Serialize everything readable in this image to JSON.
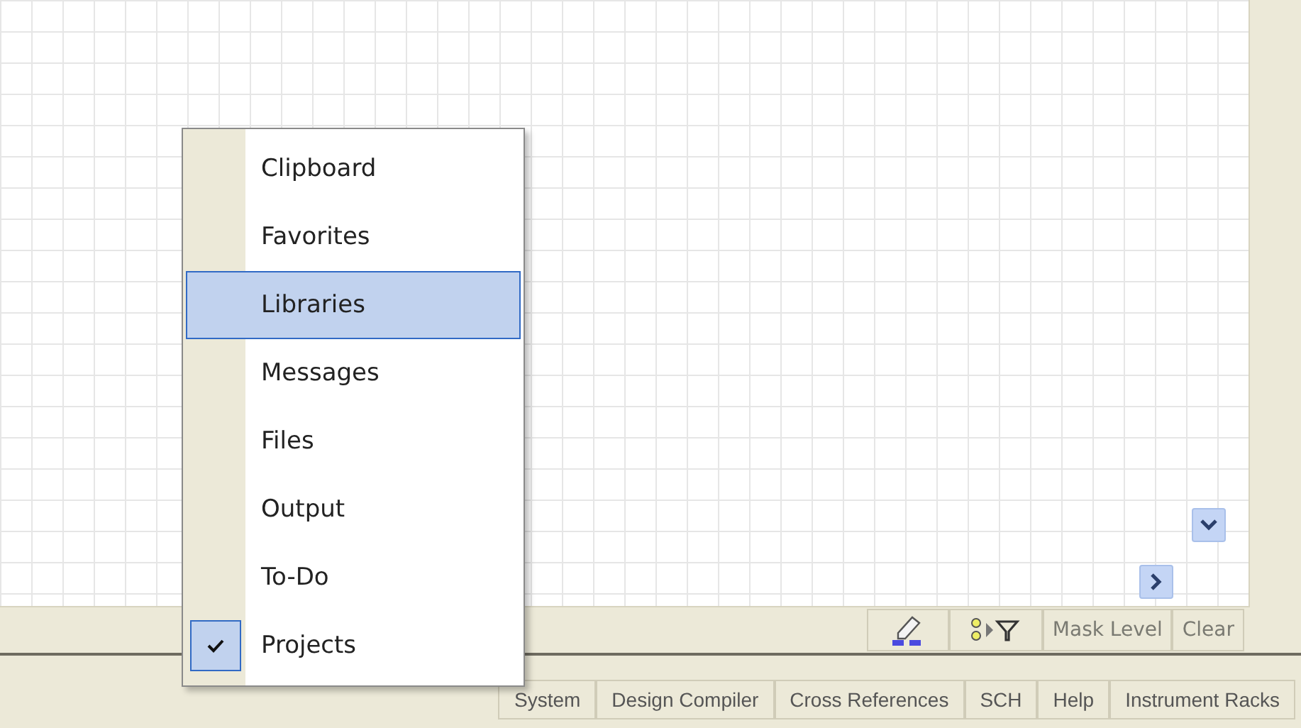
{
  "popup_menu": {
    "items": [
      {
        "label": "Clipboard",
        "selected": false,
        "checked": false
      },
      {
        "label": "Favorites",
        "selected": false,
        "checked": false
      },
      {
        "label": "Libraries",
        "selected": true,
        "checked": false
      },
      {
        "label": "Messages",
        "selected": false,
        "checked": false
      },
      {
        "label": "Files",
        "selected": false,
        "checked": false
      },
      {
        "label": "Output",
        "selected": false,
        "checked": false
      },
      {
        "label": "To-Do",
        "selected": false,
        "checked": false
      },
      {
        "label": "Projects",
        "selected": false,
        "checked": true
      }
    ]
  },
  "toolbar": {
    "buttons": [
      {
        "kind": "eraser"
      },
      {
        "kind": "filter"
      },
      {
        "kind": "text",
        "label": "Mask Level"
      },
      {
        "kind": "text",
        "label": "Clear"
      }
    ]
  },
  "status_tabs": [
    "System",
    "Design Compiler",
    "Cross References",
    "SCH",
    "Help",
    "Instrument Racks"
  ]
}
